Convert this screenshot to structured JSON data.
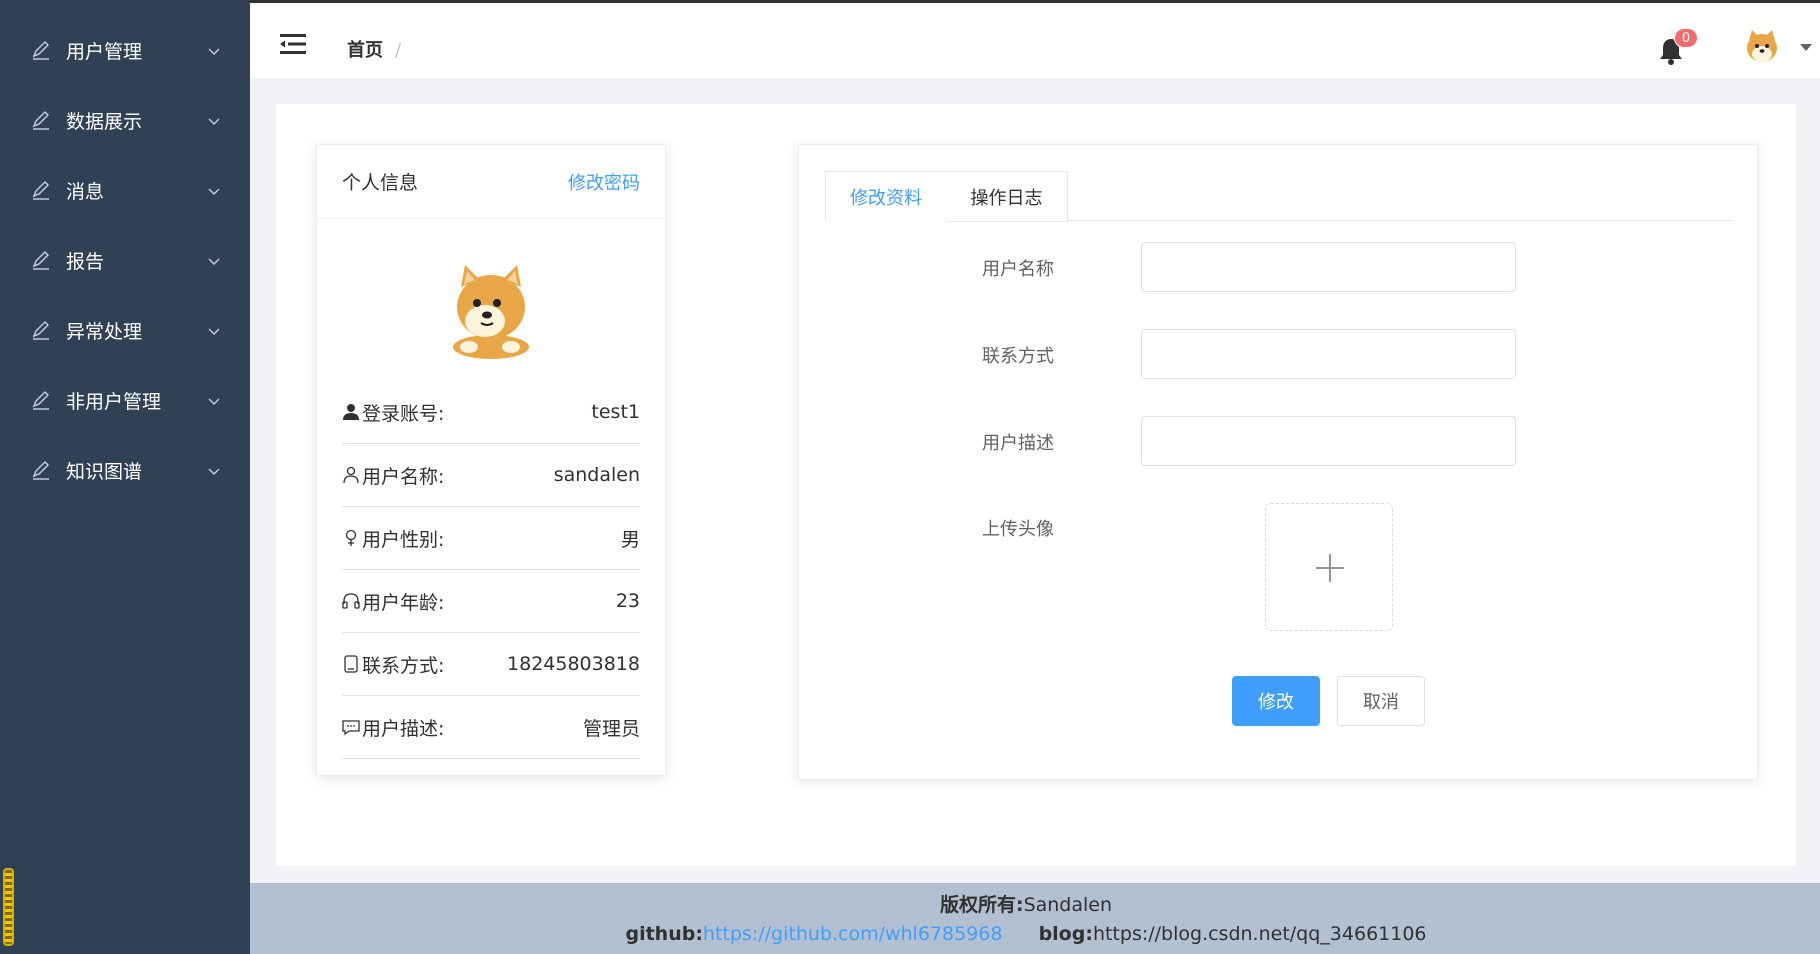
{
  "sidebar": {
    "items": [
      {
        "label": "用户管理"
      },
      {
        "label": "数据展示"
      },
      {
        "label": "消息"
      },
      {
        "label": "报告"
      },
      {
        "label": "异常处理"
      },
      {
        "label": "非用户管理"
      },
      {
        "label": "知识图谱"
      }
    ]
  },
  "header": {
    "breadcrumb_home": "首页",
    "breadcrumb_sep": "/",
    "notification_count": "0"
  },
  "profile": {
    "title": "个人信息",
    "change_password": "修改密码",
    "rows": [
      {
        "label": "登录账号:",
        "value": "test1",
        "icon": "user-filled-icon"
      },
      {
        "label": "用户名称:",
        "value": "sandalen",
        "icon": "user-outline-icon"
      },
      {
        "label": "用户性别:",
        "value": "男",
        "icon": "female-icon"
      },
      {
        "label": "用户年龄:",
        "value": "23",
        "icon": "headset-icon"
      },
      {
        "label": "联系方式:",
        "value": "18245803818",
        "icon": "mobile-icon"
      },
      {
        "label": "用户描述:",
        "value": "管理员",
        "icon": "message-icon"
      }
    ]
  },
  "edit": {
    "tabs": [
      {
        "label": "修改资料"
      },
      {
        "label": "操作日志"
      }
    ],
    "fields": [
      {
        "label": "用户名称",
        "value": "",
        "placeholder": ""
      },
      {
        "label": "联系方式",
        "value": "",
        "placeholder": ""
      },
      {
        "label": "用户描述",
        "value": "",
        "placeholder": ""
      }
    ],
    "upload_label": "上传头像",
    "submit_label": "修改",
    "cancel_label": "取消"
  },
  "footer": {
    "copyright_label": "版权所有:",
    "copyright_value": "Sandalen",
    "github_label": "github:",
    "github_url": "https://github.com/whl6785968",
    "blog_label": "blog:",
    "blog_url": "https://blog.csdn.net/qq_34661106"
  },
  "colors": {
    "sidebar_bg": "#304156",
    "primary": "#409eff",
    "badge": "#f56c6c",
    "footer_bg": "#b3c0d1"
  }
}
